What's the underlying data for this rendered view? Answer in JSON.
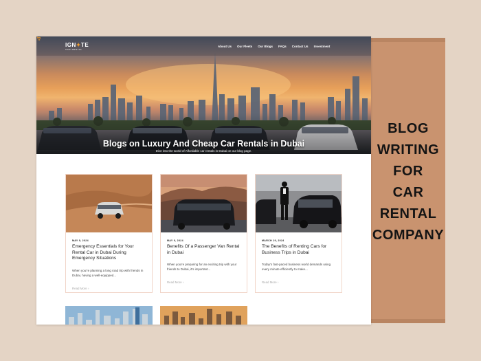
{
  "site": {
    "brand_first": "IGN",
    "brand_flame": "✦",
    "brand_last": "TE",
    "brand_sub": "CAR RENTAL",
    "nav": [
      "About Us",
      "Our Fleets",
      "Our Blogs",
      "FAQs",
      "Contact Us",
      "Investment"
    ],
    "cart_icon": "cart-icon",
    "hero_title": "Blogs on Luxury And Cheap Car Rentals in Dubai",
    "hero_subtitle": "Dive into the world of Affordable car rentals in Dubai on our blog page."
  },
  "posts": [
    {
      "date": "MAY 9, 2024",
      "title": "Emergency Essentials for Your Rental Car in Dubai During Emergency Situations",
      "excerpt": "When you're planning a long road trip with friends in Dubai, having a well-equipped...",
      "read_more": "Read More",
      "read_more_icon": "chevron-right-icon",
      "image": "suv-in-desert-dunes"
    },
    {
      "date": "MAY 9, 2024",
      "title": "Benefits Of a Passenger Van Rental in Dubai",
      "excerpt": "When you're preparing for an exciting trip with your friends to Dubai, it's important...",
      "read_more": "Read More",
      "read_more_icon": "chevron-right-icon",
      "image": "black-van-mountain-road"
    },
    {
      "date": "MARCH 19, 2024",
      "title": "The Benefits of Renting Cars for Business Trips in Dubai",
      "excerpt": "Today's fast-paced business world demands using every minute efficiently to make...",
      "read_more": "Read More",
      "read_more_icon": "chevron-right-icon",
      "image": "chauffeur-luxury-sedan"
    }
  ],
  "caption_lines": [
    "BLOG",
    "WRITING",
    "FOR",
    "CAR",
    "RENTAL",
    "COMPANY"
  ],
  "colors": {
    "background": "#e4d4c5",
    "panel": "#c9936f",
    "card_border": "#f1d5c8",
    "logo_accent": "#f39c2a"
  }
}
